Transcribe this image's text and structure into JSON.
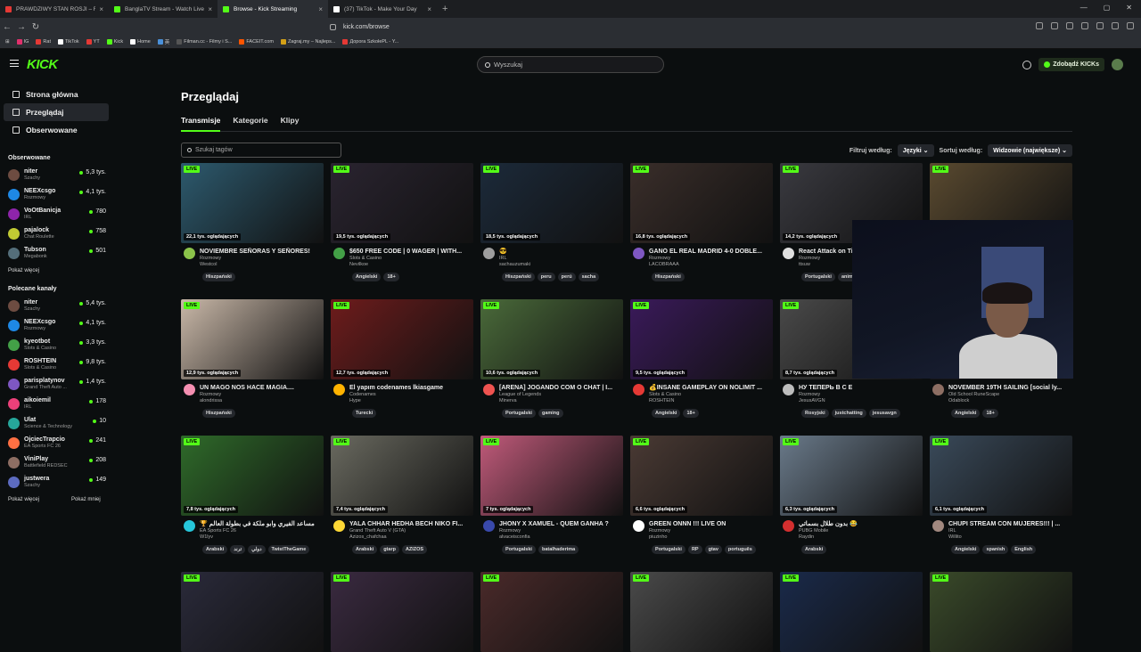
{
  "browser": {
    "tabs": [
      {
        "title": "PRAWDZIWY STAN ROSJI – ROPA, ZŁ",
        "icon": "youtube-icon",
        "color": "#e53935",
        "active": false
      },
      {
        "title": "BanglaTV Stream - Watch Live on",
        "icon": "kick-icon",
        "color": "#53fc18",
        "active": false
      },
      {
        "title": "Browse - Kick Streaming",
        "icon": "kick-icon",
        "color": "#53fc18",
        "active": true
      },
      {
        "title": "(37) TikTok - Make Your Day",
        "icon": "tiktok-icon",
        "color": "#ffffff",
        "active": false
      }
    ],
    "url": "kick.com/browse",
    "bookmarks": [
      {
        "label": "IG",
        "color": "#e1306c"
      },
      {
        "label": "Rat",
        "color": "#e53935"
      },
      {
        "label": "TikTok",
        "color": "#ffffff"
      },
      {
        "label": "YT",
        "color": "#e53935"
      },
      {
        "label": "Kick",
        "color": "#53fc18"
      },
      {
        "label": "Home",
        "color": "#ffffff"
      },
      {
        "label": "英",
        "color": "#4a90d9"
      },
      {
        "label": "Filman.cc - Filmy i S...",
        "color": "#555555"
      },
      {
        "label": "FACEIT.com",
        "color": "#ff5500"
      },
      {
        "label": "Zagraj.my – Najleps...",
        "color": "#d4a017"
      },
      {
        "label": "Дорога SzkołePL - Y...",
        "color": "#e53935"
      }
    ]
  },
  "header": {
    "logo": "KICK",
    "search_placeholder": "Wyszukaj",
    "kicks_button": "Zdobądź KICKs"
  },
  "sidebar": {
    "nav": [
      {
        "label": "Strona główna",
        "icon": "home-icon",
        "active": false
      },
      {
        "label": "Przeglądaj",
        "icon": "browse-icon",
        "active": true
      },
      {
        "label": "Obserwowane",
        "icon": "heart-icon",
        "active": false
      }
    ],
    "followed_title": "Obserwowane",
    "followed": [
      {
        "name": "niter",
        "category": "Szachy",
        "viewers": "5,3 tys.",
        "color": "#6d4c41"
      },
      {
        "name": "NEEXcsgo",
        "category": "Rozmowy",
        "viewers": "4,1 tys.",
        "color": "#1e88e5"
      },
      {
        "name": "VoOtBanicja",
        "category": "IRL",
        "viewers": "780",
        "color": "#8e24aa"
      },
      {
        "name": "pajalock",
        "category": "Chat Roulette",
        "viewers": "758",
        "color": "#c0ca33"
      },
      {
        "name": "Tubson",
        "category": "Megabonk",
        "viewers": "501",
        "color": "#546e7a"
      }
    ],
    "show_more": "Pokaż więcej",
    "recommended_title": "Polecane kanały",
    "recommended": [
      {
        "name": "niter",
        "category": "Szachy",
        "viewers": "5,4 tys.",
        "color": "#6d4c41"
      },
      {
        "name": "NEEXcsgo",
        "category": "Rozmowy",
        "viewers": "4,1 tys.",
        "color": "#1e88e5"
      },
      {
        "name": "kyeotbot",
        "category": "Slots & Casino",
        "viewers": "3,3 tys.",
        "color": "#43a047"
      },
      {
        "name": "ROSHTEIN",
        "category": "Slots & Casino",
        "viewers": "9,8 tys.",
        "color": "#e53935"
      },
      {
        "name": "parisplatynov",
        "category": "Grand Theft Auto ...",
        "viewers": "1,4 tys.",
        "color": "#7e57c2"
      },
      {
        "name": "aikoiemil",
        "category": "IRL",
        "viewers": "178",
        "color": "#ec407a"
      },
      {
        "name": "Ulat",
        "category": "Science & Technology",
        "viewers": "10",
        "color": "#26a69a"
      },
      {
        "name": "OjciecTrapcio",
        "category": "EA Sports FC 26",
        "viewers": "241",
        "color": "#ff7043"
      },
      {
        "name": "ViniPlay",
        "category": "Battlefield REDSEC",
        "viewers": "208",
        "color": "#8d6e63"
      },
      {
        "name": "justwera",
        "category": "Szachy",
        "viewers": "149",
        "color": "#5c6bc0"
      }
    ],
    "show_more_2": "Pokaż więcej",
    "show_less": "Pokaż mniej"
  },
  "main": {
    "title": "Przeglądaj",
    "tabs": [
      "Transmisje",
      "Kategorie",
      "Klipy"
    ],
    "tag_search_placeholder": "Szukaj tagów",
    "filter_label": "Filtruj według:",
    "filter_value": "Języki",
    "sort_label": "Sortuj według:",
    "sort_value": "Widzowie (największe)"
  },
  "streams": [
    {
      "title": "NOVIEMBRE SEÑORAS Y SEÑORES!",
      "category": "Rozmowy",
      "user": "Westcol",
      "viewers": "22,1 tys. oglądających",
      "tags": [
        "Hiszpański"
      ],
      "thumb": "#2d5a6e",
      "avatar": "#8bc34a"
    },
    {
      "title": "$650 FREE CODE | 0 WAGER | WITH...",
      "category": "Slots & Casino",
      "user": "Nevilkoe",
      "viewers": "19,5 tys. oglądających",
      "tags": [
        "Angielski",
        "18+"
      ],
      "thumb": "#2a2430",
      "avatar": "#43a047"
    },
    {
      "title": "😎",
      "category": "IRL",
      "user": "sachauzumaki",
      "viewers": "18,5 tys. oglądających",
      "tags": [
        "Hiszpański",
        "peru",
        "perú",
        "sacha"
      ],
      "thumb": "#1c2a3a",
      "avatar": "#9e9e9e"
    },
    {
      "title": "GANÓ EL REAL MADRID 4-0 DOBLE...",
      "category": "Rozmowy",
      "user": "LACOBRAAA",
      "viewers": "16,8 tys. oglądających",
      "tags": [
        "Hiszpański"
      ],
      "thumb": "#3a2e2a",
      "avatar": "#7e57c2"
    },
    {
      "title": "React Attack on Titan",
      "category": "Rozmowy",
      "user": "ttsuw",
      "viewers": "14,2 tys. oglądających",
      "tags": [
        "Portugalski",
        "anime"
      ],
      "thumb": "#3a3a40",
      "avatar": "#e0e0e0"
    },
    {
      "title": "",
      "category": "",
      "user": "",
      "viewers": "",
      "tags": [],
      "thumb": "#5a4a30",
      "avatar": "#000000"
    },
    {
      "title": "UN MAGO NOS HACE MAGIA....",
      "category": "Rozmowy",
      "user": "alondrissa",
      "viewers": "12,9 tys. oglądających",
      "tags": [
        "Hiszpański"
      ],
      "thumb": "#c9b8a8",
      "avatar": "#f48fb1"
    },
    {
      "title": "El yapım codenames İkiasgame",
      "category": "Codenames",
      "user": "Hype",
      "viewers": "12,7 tys. oglądających",
      "tags": [
        "Turecki"
      ],
      "thumb": "#6e1c1c",
      "avatar": "#ffb300"
    },
    {
      "title": "[ARENA] JOGANDO COM O CHAT | I...",
      "category": "League of Legends",
      "user": "Minerva",
      "viewers": "10,6 tys. oglądających",
      "tags": [
        "Portugalski",
        "gaming"
      ],
      "thumb": "#4a6a3a",
      "avatar": "#ef5350"
    },
    {
      "title": "💰INSANE GAMEPLAY ON NOLIMIT ...",
      "category": "Slots & Casino",
      "user": "ROSHTEIN",
      "viewers": "9,5 tys. oglądających",
      "tags": [
        "Angielski",
        "18+"
      ],
      "thumb": "#3a1a5a",
      "avatar": "#e53935"
    },
    {
      "title": "НУ ТЕПЕРЬ В С Е",
      "category": "Rozmowy",
      "user": "JesusAVGN",
      "viewers": "8,7 tys. oglądających",
      "tags": [
        "Rosyjski",
        "justchatting",
        "jesusavgn"
      ],
      "thumb": "#4a4a4a",
      "avatar": "#bdbdbd"
    },
    {
      "title": "NOVEMBER 19TH SAILING [social ly...",
      "category": "Old School RuneScape",
      "user": "Odablock",
      "viewers": "",
      "tags": [
        "Angielski",
        "18+"
      ],
      "thumb": "#1a1a22",
      "avatar": "#8d6e63"
    },
    {
      "title": "🏆 مساعد الفيري وابو ملكة في بطولة العالم",
      "category": "EA Sports FC 26",
      "user": "W1lyv",
      "viewers": "7,8 tys. oglądających",
      "tags": [
        "Arabski",
        "ترند",
        "دولي",
        "TwistTheGame"
      ],
      "thumb": "#2f6b2a",
      "avatar": "#26c6da"
    },
    {
      "title": "YALA CHHAR HEDHA BECH NIKO FI...",
      "category": "Grand Theft Auto V (GTA)",
      "user": "Azizos_chafchaa",
      "viewers": "7,4 tys. oglądających",
      "tags": [
        "Arabski",
        "gtarp",
        "AZIZOS"
      ],
      "thumb": "#6a6a60",
      "avatar": "#fdd835"
    },
    {
      "title": "JHONY X XAMUEL - QUEM GANHA ?",
      "category": "Rozmowy",
      "user": "alvaceisconfia",
      "viewers": "7 tys. oglądających",
      "tags": [
        "Portugalski",
        "batalhaderima"
      ],
      "thumb": "#c05a7a",
      "avatar": "#3949ab"
    },
    {
      "title": "GREEN ONNN !!! LIVE ON",
      "category": "Rozmowy",
      "user": "piuzinho",
      "viewers": "6,6 tys. oglądających",
      "tags": [
        "Portugalski",
        "RP",
        "gtav",
        "português"
      ],
      "thumb": "#4a3a34",
      "avatar": "#ffffff"
    },
    {
      "title": "بدون طلال بسماتي 😂",
      "category": "PUBG Mobile",
      "user": "Raydin",
      "viewers": "6,3 tys. oglądających",
      "tags": [
        "Arabski"
      ],
      "thumb": "#6a7a8a",
      "avatar": "#d32f2f"
    },
    {
      "title": "CHUPI STREAM CON MUJERES!!! | ...",
      "category": "IRL",
      "user": "Willito",
      "viewers": "6,1 tys. oglądających",
      "tags": [
        "Angielski",
        "spanish",
        "English"
      ],
      "thumb": "#3a4a5a",
      "avatar": "#a1887f"
    },
    {
      "title": "",
      "category": "",
      "user": "",
      "viewers": "",
      "tags": [],
      "thumb": "#2a2a3a",
      "avatar": "#000000"
    },
    {
      "title": "",
      "category": "",
      "user": "",
      "viewers": "",
      "tags": [],
      "thumb": "#3a2a40",
      "avatar": "#000000"
    },
    {
      "title": "",
      "category": "",
      "user": "",
      "viewers": "",
      "tags": [],
      "thumb": "#4a2a2a",
      "avatar": "#000000"
    },
    {
      "title": "",
      "category": "",
      "user": "",
      "viewers": "",
      "tags": [],
      "thumb": "#4a4a4a",
      "avatar": "#000000"
    },
    {
      "title": "",
      "category": "",
      "user": "",
      "viewers": "",
      "tags": [],
      "thumb": "#1a2a4a",
      "avatar": "#000000"
    },
    {
      "title": "",
      "category": "",
      "user": "",
      "viewers": "",
      "tags": [],
      "thumb": "#3a4a2a",
      "avatar": "#000000"
    }
  ],
  "live_badge": "LIVE",
  "colors": {
    "accent": "#53fc18",
    "background": "#0b0e0f"
  }
}
